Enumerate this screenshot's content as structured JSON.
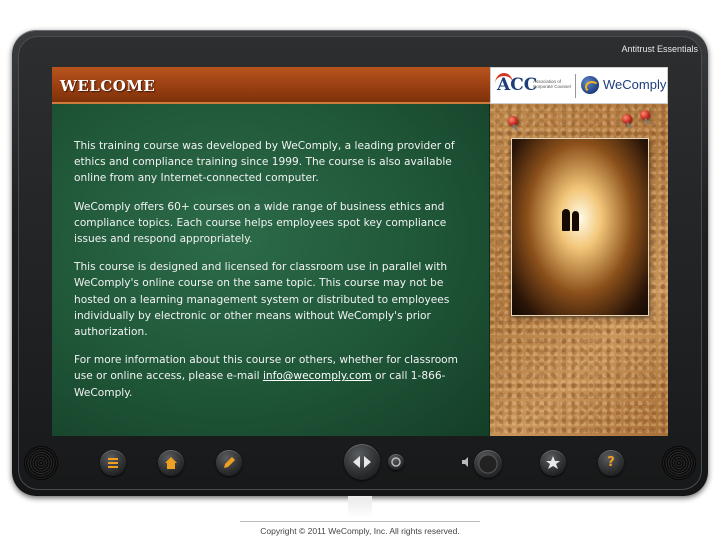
{
  "header": {
    "course_title": "Antitrust Essentials"
  },
  "title_bar": {
    "title": "WELCOME"
  },
  "logos": {
    "acc_mark": "ACC",
    "acc_text": "Association of Corporate Counsel",
    "wecomply": "WeComply"
  },
  "content": {
    "p1": "This training course was developed by WeComply, a leading provider of ethics and compliance training since 1999.  The course is also available online from any Internet-connected computer.",
    "p2": "WeComply offers 60+ courses on a wide range of business ethics and compliance topics.  Each course helps employees spot key compliance issues and respond appropriately.",
    "p3": "This course is designed and licensed for classroom use in parallel with WeComply's online course on the same topic.  This course may not be hosted on a learning management system or distributed to employees individually by electronic or other means without WeComply's prior authorization.",
    "p4_before": "For more information about this course or others, whether for classroom use or online access, please e-mail ",
    "p4_link": "info@wecomply.com",
    "p4_after": " or call 1-866-WeComply."
  },
  "controls": {
    "menu_icon": "list-icon",
    "home_icon": "home-icon",
    "notes_icon": "pencil-icon",
    "prev_icon": "triangle-left-icon",
    "next_icon": "triangle-right-icon",
    "replay_icon": "replay-icon",
    "volume_icon": "speaker-icon",
    "bookmark_icon": "star-icon",
    "help_label": "?"
  },
  "footer": {
    "copyright": "Copyright © 2011 WeComply, Inc.  All rights reserved."
  },
  "colors": {
    "title_bar": "#9a3f12",
    "board": "#1f5638",
    "accent": "#f0a020"
  }
}
